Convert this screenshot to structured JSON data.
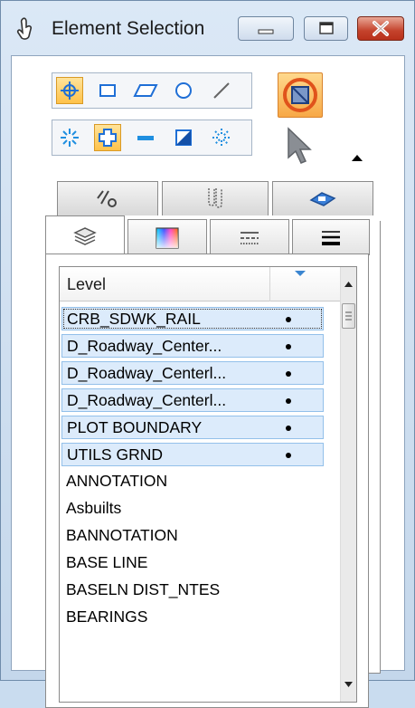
{
  "window": {
    "title": "Element Selection",
    "icon": "cursor-hand-icon"
  },
  "window_buttons": [
    {
      "name": "minimize",
      "icon": "minimize-icon"
    },
    {
      "name": "maximize",
      "icon": "maximize-icon"
    },
    {
      "name": "close",
      "icon": "close-icon"
    }
  ],
  "selection_tools": {
    "row1": [
      {
        "name": "individual",
        "icon": "individual-crosshair-icon",
        "selected": true
      },
      {
        "name": "block",
        "icon": "block-icon",
        "selected": false
      },
      {
        "name": "shape",
        "icon": "shape-icon",
        "selected": false
      },
      {
        "name": "circle",
        "icon": "circle-icon",
        "selected": false
      },
      {
        "name": "line",
        "icon": "line-icon",
        "selected": false
      }
    ],
    "row2": [
      {
        "name": "new",
        "icon": "new-sparkle-icon",
        "selected": false
      },
      {
        "name": "add",
        "icon": "add-icon",
        "selected": true
      },
      {
        "name": "subtract",
        "icon": "subtract-icon",
        "selected": false
      },
      {
        "name": "invert",
        "icon": "invert-icon",
        "selected": false
      },
      {
        "name": "clear",
        "icon": "clear-sparkle-icon",
        "selected": false
      }
    ],
    "big_button_icon": "selection-mode-icon",
    "cursor_icon": "pointer-cursor-icon",
    "expand_icon": "triangle-up-icon"
  },
  "tabs_back": [
    {
      "icon": "line-style-icon"
    },
    {
      "icon": "weight-icon"
    },
    {
      "icon": "class-icon"
    }
  ],
  "tabs_front": [
    {
      "icon": "levels-icon",
      "active": true
    },
    {
      "icon": "color-icon",
      "active": false
    },
    {
      "icon": "line-style-dash-icon",
      "active": false
    },
    {
      "icon": "line-weight-icon",
      "active": false
    }
  ],
  "accent": "#ffc24a",
  "highlight": "#dcebfb",
  "list": {
    "header": "Level",
    "rows": [
      {
        "label": "CRB_SDWK_RAIL",
        "selected": true,
        "focus": true
      },
      {
        "label": "D_Roadway_Center...",
        "selected": true
      },
      {
        "label": "D_Roadway_Centerl...",
        "selected": true
      },
      {
        "label": "D_Roadway_Centerl...",
        "selected": true
      },
      {
        "label": "PLOT BOUNDARY",
        "selected": true
      },
      {
        "label": "UTILS GRND",
        "selected": true
      },
      {
        "label": "ANNOTATION",
        "selected": false
      },
      {
        "label": "Asbuilts",
        "selected": false
      },
      {
        "label": "BANNOTATION",
        "selected": false
      },
      {
        "label": "BASE LINE",
        "selected": false
      },
      {
        "label": "BASELN DIST_NTES",
        "selected": false
      },
      {
        "label": "BEARINGS",
        "selected": false
      }
    ]
  }
}
